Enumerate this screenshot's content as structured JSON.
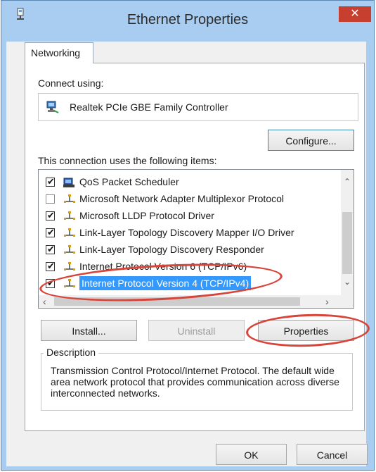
{
  "window": {
    "title": "Ethernet Properties",
    "close_glyph": "✕"
  },
  "tabs": [
    {
      "label": "Networking"
    }
  ],
  "connect_using": {
    "label": "Connect using:",
    "adapter": "Realtek PCIe GBE Family Controller",
    "configure_button": "Configure..."
  },
  "items": {
    "label": "This connection uses the following items:",
    "list": [
      {
        "label": "QoS Packet Scheduler",
        "checked": true,
        "icon": "qos-scheduler-icon",
        "selected": false
      },
      {
        "label": "Microsoft Network Adapter Multiplexor Protocol",
        "checked": false,
        "icon": "network-protocol-icon",
        "selected": false
      },
      {
        "label": "Microsoft LLDP Protocol Driver",
        "checked": true,
        "icon": "network-protocol-icon",
        "selected": false
      },
      {
        "label": "Link-Layer Topology Discovery Mapper I/O Driver",
        "checked": true,
        "icon": "network-protocol-icon",
        "selected": false
      },
      {
        "label": "Link-Layer Topology Discovery Responder",
        "checked": true,
        "icon": "network-protocol-icon",
        "selected": false
      },
      {
        "label": "Internet Protocol Version 6 (TCP/IPv6)",
        "checked": true,
        "icon": "network-protocol-icon",
        "selected": false
      },
      {
        "label": "Internet Protocol Version 4 (TCP/IPv4)",
        "checked": true,
        "icon": "network-protocol-icon",
        "selected": true
      }
    ]
  },
  "buttons": {
    "install": "Install...",
    "uninstall": "Uninstall",
    "properties": "Properties",
    "ok": "OK",
    "cancel": "Cancel"
  },
  "description": {
    "legend": "Description",
    "text": "Transmission Control Protocol/Internet Protocol. The default wide area network protocol that provides communication across diverse interconnected networks."
  },
  "colors": {
    "titlebar": "#a9cdf0",
    "close_button": "#c7402f",
    "selection": "#3399ff",
    "annotation": "#d6443a"
  }
}
